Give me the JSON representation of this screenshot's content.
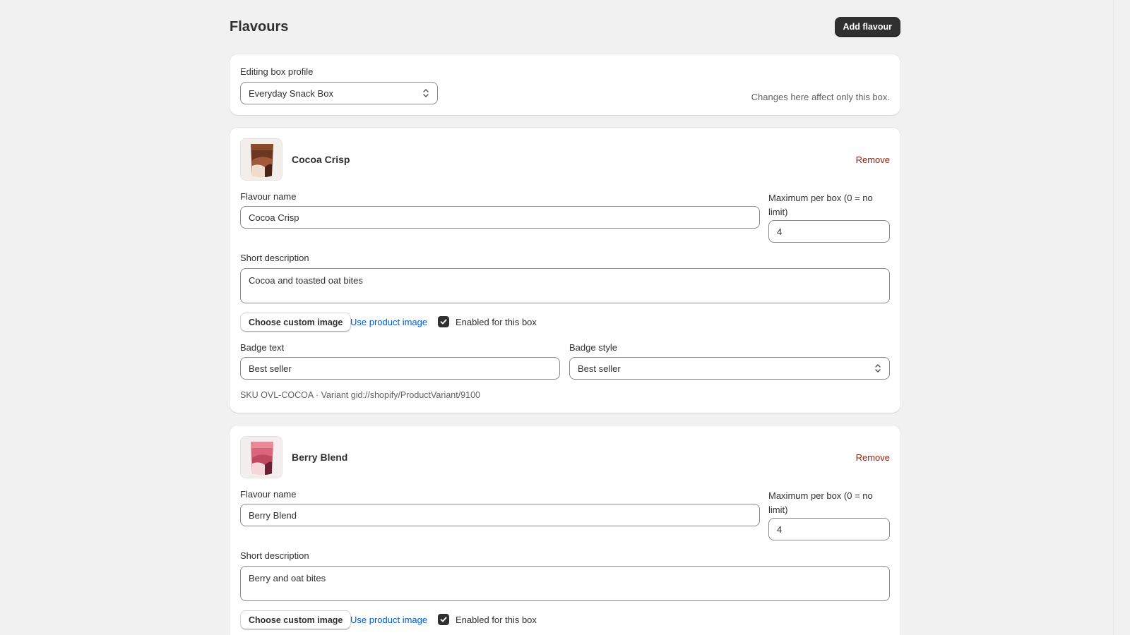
{
  "header": {
    "title": "Flavours",
    "add_button_label": "Add flavour"
  },
  "profile": {
    "label": "Editing box profile",
    "selected": "Everyday Snack Box",
    "help_text": "Changes here affect only this box."
  },
  "flavours": [
    {
      "title": "Cocoa Crisp",
      "remove_label": "Remove",
      "name_label": "Flavour name",
      "name_value": "Cocoa Crisp",
      "max_label": "Maximum per box (0 = no limit)",
      "max_value": "4",
      "desc_label": "Short description",
      "desc_value": "Cocoa and toasted oat bites",
      "choose_image_label": "Choose custom image",
      "use_product_image_label": "Use product image",
      "enabled_label": "Enabled for this box",
      "enabled": true,
      "badge_text_label": "Badge text",
      "badge_text_value": "Best seller",
      "badge_style_label": "Badge style",
      "badge_style_value": "Best seller",
      "meta": "SKU OVL-COCOA · Variant gid://shopify/ProductVariant/9100"
    },
    {
      "title": "Berry Blend",
      "remove_label": "Remove",
      "name_label": "Flavour name",
      "name_value": "Berry Blend",
      "max_label": "Maximum per box (0 = no limit)",
      "max_value": "4",
      "desc_label": "Short description",
      "desc_value": "Berry and oat bites",
      "choose_image_label": "Choose custom image",
      "use_product_image_label": "Use product image",
      "enabled_label": "Enabled for this box",
      "enabled": true
    }
  ],
  "colors": {
    "page_background": "#f1f1f1",
    "primary_button": "#303030",
    "link": "#005bd3",
    "critical_link": "#8e1f0b"
  },
  "icons": {
    "select_chevron": "chevron-up-down-icon",
    "checkbox_check": "checkmark-icon"
  }
}
